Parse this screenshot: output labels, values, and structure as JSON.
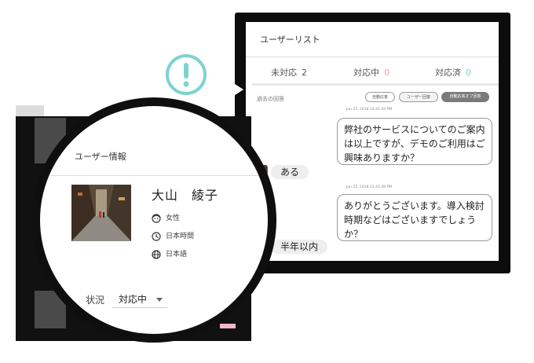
{
  "chat": {
    "title": "ユーザーリスト",
    "tabs": [
      {
        "label": "未対応",
        "count": "2"
      },
      {
        "label": "対応中",
        "count": "0"
      },
      {
        "label": "対応済",
        "count": "0"
      }
    ],
    "history_label": "過去の回答",
    "chips": [
      "自動応答",
      "ユーザー回答",
      "自動応答オフ回答"
    ],
    "messages": [
      {
        "timestamp": "Jun 25, 2018 12:41:44 PM",
        "text": "弊社のサービスについてのご案内は以上ですが、デモのご利用はご興味ありますか？"
      },
      {
        "reply": "ある"
      },
      {
        "timestamp": "Jun 25, 2018 12:41:49 PM",
        "text": "ありがとうございます。導入検討時期などはございますでしょうか？"
      },
      {
        "reply": "半年以内"
      }
    ]
  },
  "user_info": {
    "title": "ユーザー情報",
    "name": "大山　綾子",
    "gender": "女性",
    "timezone": "日本時間",
    "language": "日本語",
    "status_label": "状況",
    "status_value": "対応中"
  },
  "colors": {
    "accent_teal": "#7cd3d0",
    "accent_pink": "#f0a3a3"
  },
  "icons": [
    "alert-icon",
    "face-icon",
    "clock-icon",
    "globe-icon",
    "dropdown-caret-icon"
  ]
}
